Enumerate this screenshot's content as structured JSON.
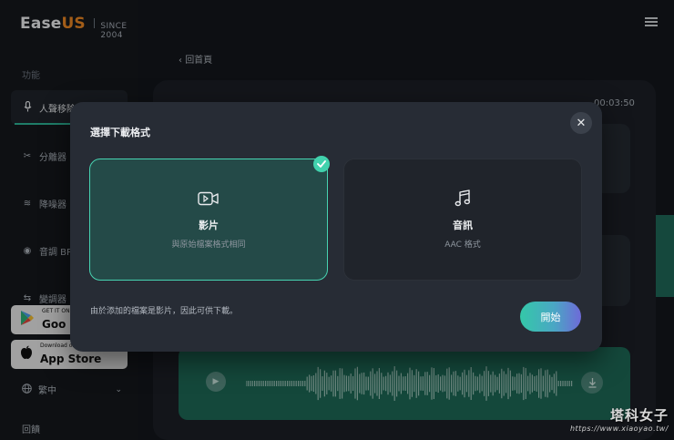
{
  "app": {
    "logo_main": "Ease",
    "logo_accent": "US",
    "tagline": "SINCE 2004"
  },
  "sidebar": {
    "section_label": "功能",
    "items": [
      {
        "label": "人聲移除",
        "icon": "microphone-icon",
        "active": true
      },
      {
        "label": "分離器",
        "icon": "scissors-icon",
        "active": false
      },
      {
        "label": "降噪器",
        "icon": "noise-icon",
        "active": false
      },
      {
        "label": "音調 BPM",
        "icon": "pitch-icon",
        "active": false
      },
      {
        "label": "變調器",
        "icon": "shift-icon",
        "active": false
      }
    ],
    "google_play_small": "GET IT ON",
    "google_play_big": "Goo",
    "app_store_small": "Download on the",
    "app_store_big": "App Store",
    "language": "繁中",
    "feedback": "回饋"
  },
  "main": {
    "back_link": "回首頁",
    "duration": "00:03:50"
  },
  "modal": {
    "title": "選擇下載格式",
    "options": [
      {
        "title": "影片",
        "subtitle": "與原始檔案格式相同",
        "icon": "video-icon",
        "selected": true
      },
      {
        "title": "音訊",
        "subtitle": "AAC 格式",
        "icon": "music-note-icon",
        "selected": false
      }
    ],
    "note": "由於添加的檔案是影片，因此可供下載。",
    "start_label": "開始"
  },
  "watermark": {
    "line1": "塔科女子",
    "line2": "https://www.xiaoyao.tw/"
  },
  "colors": {
    "accent_teal": "#41d2ad",
    "brand_orange": "#f08a24",
    "track_green": "#1e6a58"
  }
}
